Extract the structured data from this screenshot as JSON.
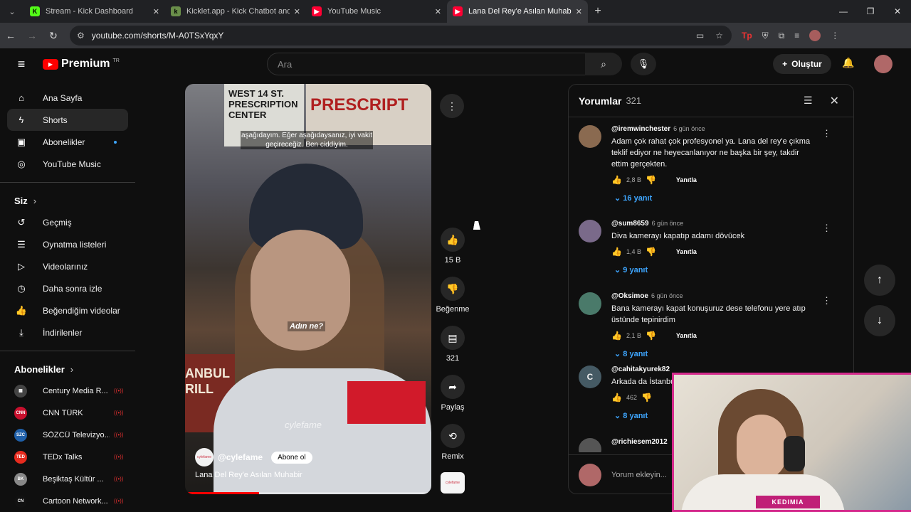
{
  "browser": {
    "tabs": [
      {
        "title": "Stream - Kick Dashboard",
        "color": "#53fc18",
        "glyph": "K"
      },
      {
        "title": "Kicklet.app - Kick Chatbot and",
        "color": "#6a8f4a",
        "glyph": "k"
      },
      {
        "title": "YouTube Music",
        "color": "#ff0033",
        "glyph": "▶"
      },
      {
        "title": "Lana Del Rey'e Asılan Muhabir",
        "color": "#ff0033",
        "glyph": "▶"
      }
    ],
    "url": "youtube.com/shorts/M-A0TSxYqxY"
  },
  "header": {
    "logo_text": "Premium",
    "logo_region": "TR",
    "search_placeholder": "Ara",
    "create_label": "Oluştur"
  },
  "sidebar": {
    "main": [
      {
        "label": "Ana Sayfa",
        "icon": "home-icon",
        "glyph": "⌂"
      },
      {
        "label": "Shorts",
        "icon": "shorts-icon",
        "glyph": "ϟ"
      },
      {
        "label": "Abonelikler",
        "icon": "subscriptions-icon",
        "glyph": "▣"
      },
      {
        "label": "YouTube Music",
        "icon": "music-icon",
        "glyph": "◎"
      }
    ],
    "you_heading": "Siz",
    "you": [
      {
        "label": "Geçmiş",
        "icon": "history-icon",
        "glyph": "↺"
      },
      {
        "label": "Oynatma listeleri",
        "icon": "playlists-icon",
        "glyph": "☰"
      },
      {
        "label": "Videolarınız",
        "icon": "your-videos-icon",
        "glyph": "▷"
      },
      {
        "label": "Daha sonra izle",
        "icon": "watch-later-icon",
        "glyph": "◷"
      },
      {
        "label": "Beğendiğim videolar",
        "icon": "liked-icon",
        "glyph": "👍"
      },
      {
        "label": "İndirilenler",
        "icon": "download-icon",
        "glyph": "⤓"
      }
    ],
    "subs_heading": "Abonelikler",
    "channels": [
      {
        "name": "Century Media R...",
        "color": "#444",
        "abbr": "▦"
      },
      {
        "name": "CNN TÜRK",
        "color": "#c8102e",
        "abbr": "CNN"
      },
      {
        "name": "SÖZCÜ Televizyo...",
        "color": "#1f5fa8",
        "abbr": "SZC"
      },
      {
        "name": "TEDx Talks",
        "color": "#e62b1e",
        "abbr": "TED"
      },
      {
        "name": "Beşiktaş Kültür ...",
        "color": "#888",
        "abbr": "BK"
      },
      {
        "name": "Cartoon Network...",
        "color": "#111",
        "abbr": "CN"
      }
    ]
  },
  "video": {
    "sign_left": "WEST 14 ST. PRESCRIPTION CENTER",
    "sign_right": "PRESCRIPT",
    "store_text": "ANBUL RILL",
    "subtitle_top": "aşağıdayım. Eğer aşağıdaysanız, iyi vakit geçireceğiz. Ben ciddiyim.",
    "subtitle_mid": "Adın ne?",
    "watermark": "cylefame",
    "channel": "@cylefame",
    "channel_avatar": "cylefame",
    "subscribe_label": "Abone ol",
    "title": "Lana Del Rey'e Asılan Muhabir",
    "progress": 0.3
  },
  "actions": {
    "likes": "15 B",
    "dislike_label": "Beğenme",
    "comments": "321",
    "share_label": "Paylaş",
    "remix_label": "Remix",
    "sound_label": "cylefame"
  },
  "comments": {
    "title": "Yorumlar",
    "count": "321",
    "reply_label": "Yanıtla",
    "input_placeholder": "Yorum ekleyin...",
    "items": [
      {
        "user": "@iremwinchester",
        "time": "6 gün önce",
        "text": "Adam çok rahat çok profesyonel ya. Lana del rey'e çıkma teklif ediyor ne heyecanlanıyor ne başka bir şey, takdir ettim gerçekten.",
        "likes": "2,8 B",
        "replies": "16 yanıt",
        "avatar_color": "#8a6a50"
      },
      {
        "user": "@sum8659",
        "time": "6 gün önce",
        "text": "Diva kamerayı kapatıp adamı dövücek",
        "likes": "1,4 B",
        "replies": "9 yanıt",
        "avatar_color": "#7a6a8a"
      },
      {
        "user": "@Oksimoe",
        "time": "6 gün önce",
        "text": "Bana kamerayı kapat konuşuruz dese telefonu yere atıp üstünde tepinirdim",
        "likes": "2,1 B",
        "replies": "8 yanıt",
        "avatar_color": "#4a7a6a"
      },
      {
        "user": "@cahitakyurek82",
        "time": "",
        "text": "Arkada da İstanbul",
        "likes": "462",
        "replies": "8 yanıt",
        "avatar_color": "#455a64",
        "initial": "C"
      },
      {
        "user": "@richiesem2012",
        "time": "",
        "text": "",
        "likes": "",
        "replies": "",
        "avatar_color": "#555"
      }
    ]
  },
  "webcam": {
    "label": "KEDIMIA"
  }
}
